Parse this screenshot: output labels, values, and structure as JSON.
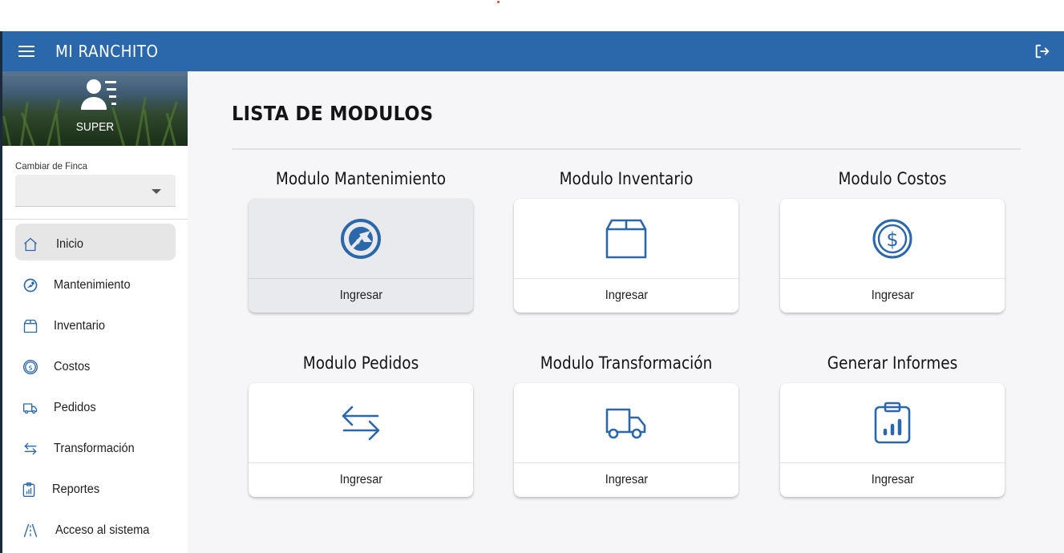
{
  "app": {
    "title": "MI RANCHITO",
    "accent_color": "#2b67ab"
  },
  "header": {
    "menu_icon": "hamburger-menu-icon",
    "logout_icon": "logout-icon"
  },
  "profile": {
    "avatar_icon": "user-list-icon",
    "name": "SUPER"
  },
  "finca": {
    "label": "Cambiar de Finca",
    "value": ""
  },
  "sidebar": {
    "items": [
      {
        "label": "Inicio",
        "icon": "home-icon",
        "active": true
      },
      {
        "label": "Mantenimiento",
        "icon": "wrench-gear-icon"
      },
      {
        "label": "Inventario",
        "icon": "box-icon"
      },
      {
        "label": "Costos",
        "icon": "dollar-coin-icon"
      },
      {
        "label": "Pedidos",
        "icon": "truck-icon"
      },
      {
        "label": "Transformación",
        "icon": "arrows-exchange-icon"
      },
      {
        "label": "Reportes",
        "icon": "clipboard-chart-icon"
      },
      {
        "label": "Acceso al sistema",
        "icon": "road-icon"
      }
    ]
  },
  "main": {
    "title": "LISTA DE MODULOS",
    "modules": [
      {
        "title": "Modulo Mantenimiento",
        "icon": "wrench-gear-icon",
        "button": "Ingresar"
      },
      {
        "title": "Modulo Inventario",
        "icon": "box-icon",
        "button": "Ingresar"
      },
      {
        "title": "Modulo Costos",
        "icon": "dollar-coin-icon",
        "button": "Ingresar"
      },
      {
        "title": "Modulo Pedidos",
        "icon": "arrows-exchange-icon",
        "button": "Ingresar"
      },
      {
        "title": "Modulo Transformación",
        "icon": "truck-icon",
        "button": "Ingresar"
      },
      {
        "title": "Generar Informes",
        "icon": "clipboard-chart-icon",
        "button": "Ingresar"
      }
    ]
  }
}
